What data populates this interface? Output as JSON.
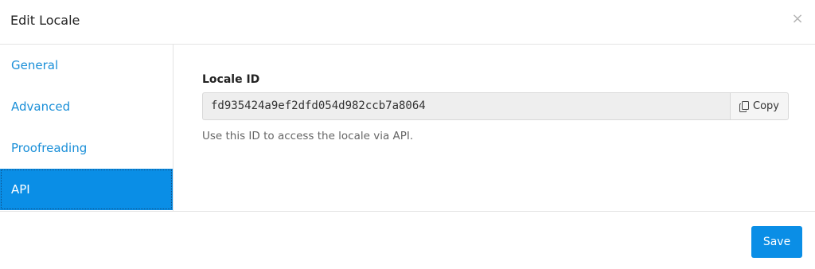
{
  "dialog": {
    "title": "Edit Locale",
    "close_glyph": "×"
  },
  "sidebar": {
    "items": [
      {
        "label": "General",
        "active": false
      },
      {
        "label": "Advanced",
        "active": false
      },
      {
        "label": "Proofreading",
        "active": false
      },
      {
        "label": "API",
        "active": true
      }
    ]
  },
  "api": {
    "field_label": "Locale ID",
    "locale_id": "fd935424a9ef2dfd054d982ccb7a8064",
    "copy_label": "Copy",
    "copy_icon": "copy-icon",
    "help_text": "Use this ID to access the locale via API."
  },
  "footer": {
    "save_label": "Save"
  },
  "colors": {
    "accent": "#0a8ee6",
    "link": "#1a8fd8",
    "input_bg": "#eeeeee",
    "border": "#e3e3e3"
  }
}
